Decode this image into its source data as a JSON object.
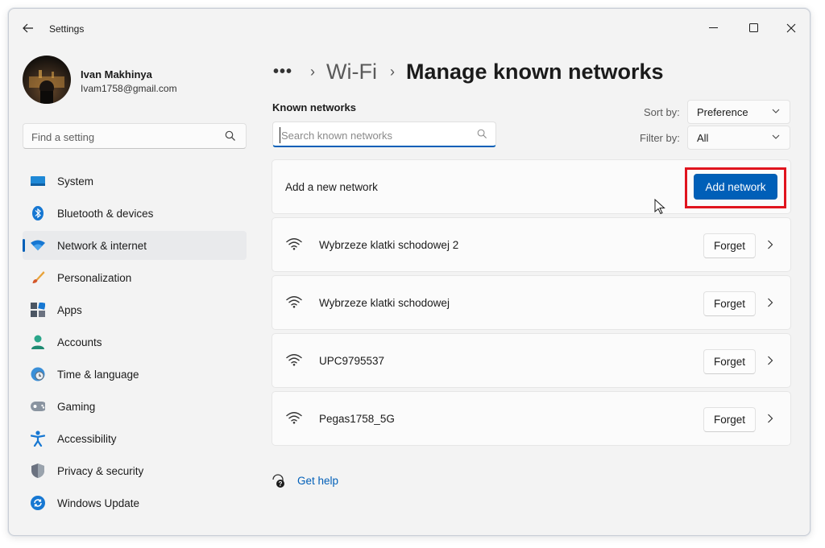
{
  "window": {
    "title": "Settings",
    "controls": [
      "minimize",
      "maximize",
      "close"
    ]
  },
  "profile": {
    "name": "Ivan Makhinya",
    "email": "Ivam1758@gmail.com"
  },
  "sidebar_search": {
    "placeholder": "Find a setting"
  },
  "nav": {
    "items": [
      {
        "label": "System",
        "icon": "system-icon"
      },
      {
        "label": "Bluetooth & devices",
        "icon": "bluetooth-icon"
      },
      {
        "label": "Network & internet",
        "icon": "wifi-icon",
        "active": true
      },
      {
        "label": "Personalization",
        "icon": "brush-icon"
      },
      {
        "label": "Apps",
        "icon": "apps-icon"
      },
      {
        "label": "Accounts",
        "icon": "person-icon"
      },
      {
        "label": "Time & language",
        "icon": "globe-clock-icon"
      },
      {
        "label": "Gaming",
        "icon": "gamepad-icon"
      },
      {
        "label": "Accessibility",
        "icon": "accessibility-icon"
      },
      {
        "label": "Privacy & security",
        "icon": "shield-icon"
      },
      {
        "label": "Windows Update",
        "icon": "update-icon"
      }
    ]
  },
  "breadcrumb": {
    "more": "•••",
    "parent": "Wi-Fi",
    "current": "Manage known networks"
  },
  "known_networks": {
    "label": "Known networks",
    "search_placeholder": "Search known networks",
    "sort_label": "Sort by:",
    "sort_value": "Preference",
    "filter_label": "Filter by:",
    "filter_value": "All",
    "add_text": "Add a new network",
    "add_button": "Add network",
    "forget_label": "Forget",
    "networks": [
      {
        "name": "Wybrzeze klatki schodowej 2"
      },
      {
        "name": "Wybrzeze klatki schodowej"
      },
      {
        "name": "UPC9795537"
      },
      {
        "name": "Pegas1758_5G"
      }
    ]
  },
  "help": {
    "label": "Get help"
  },
  "colors": {
    "accent": "#005fb8",
    "highlight_box": "#e0141e",
    "window_bg": "#f3f3f3",
    "card_bg": "#fbfbfb"
  }
}
